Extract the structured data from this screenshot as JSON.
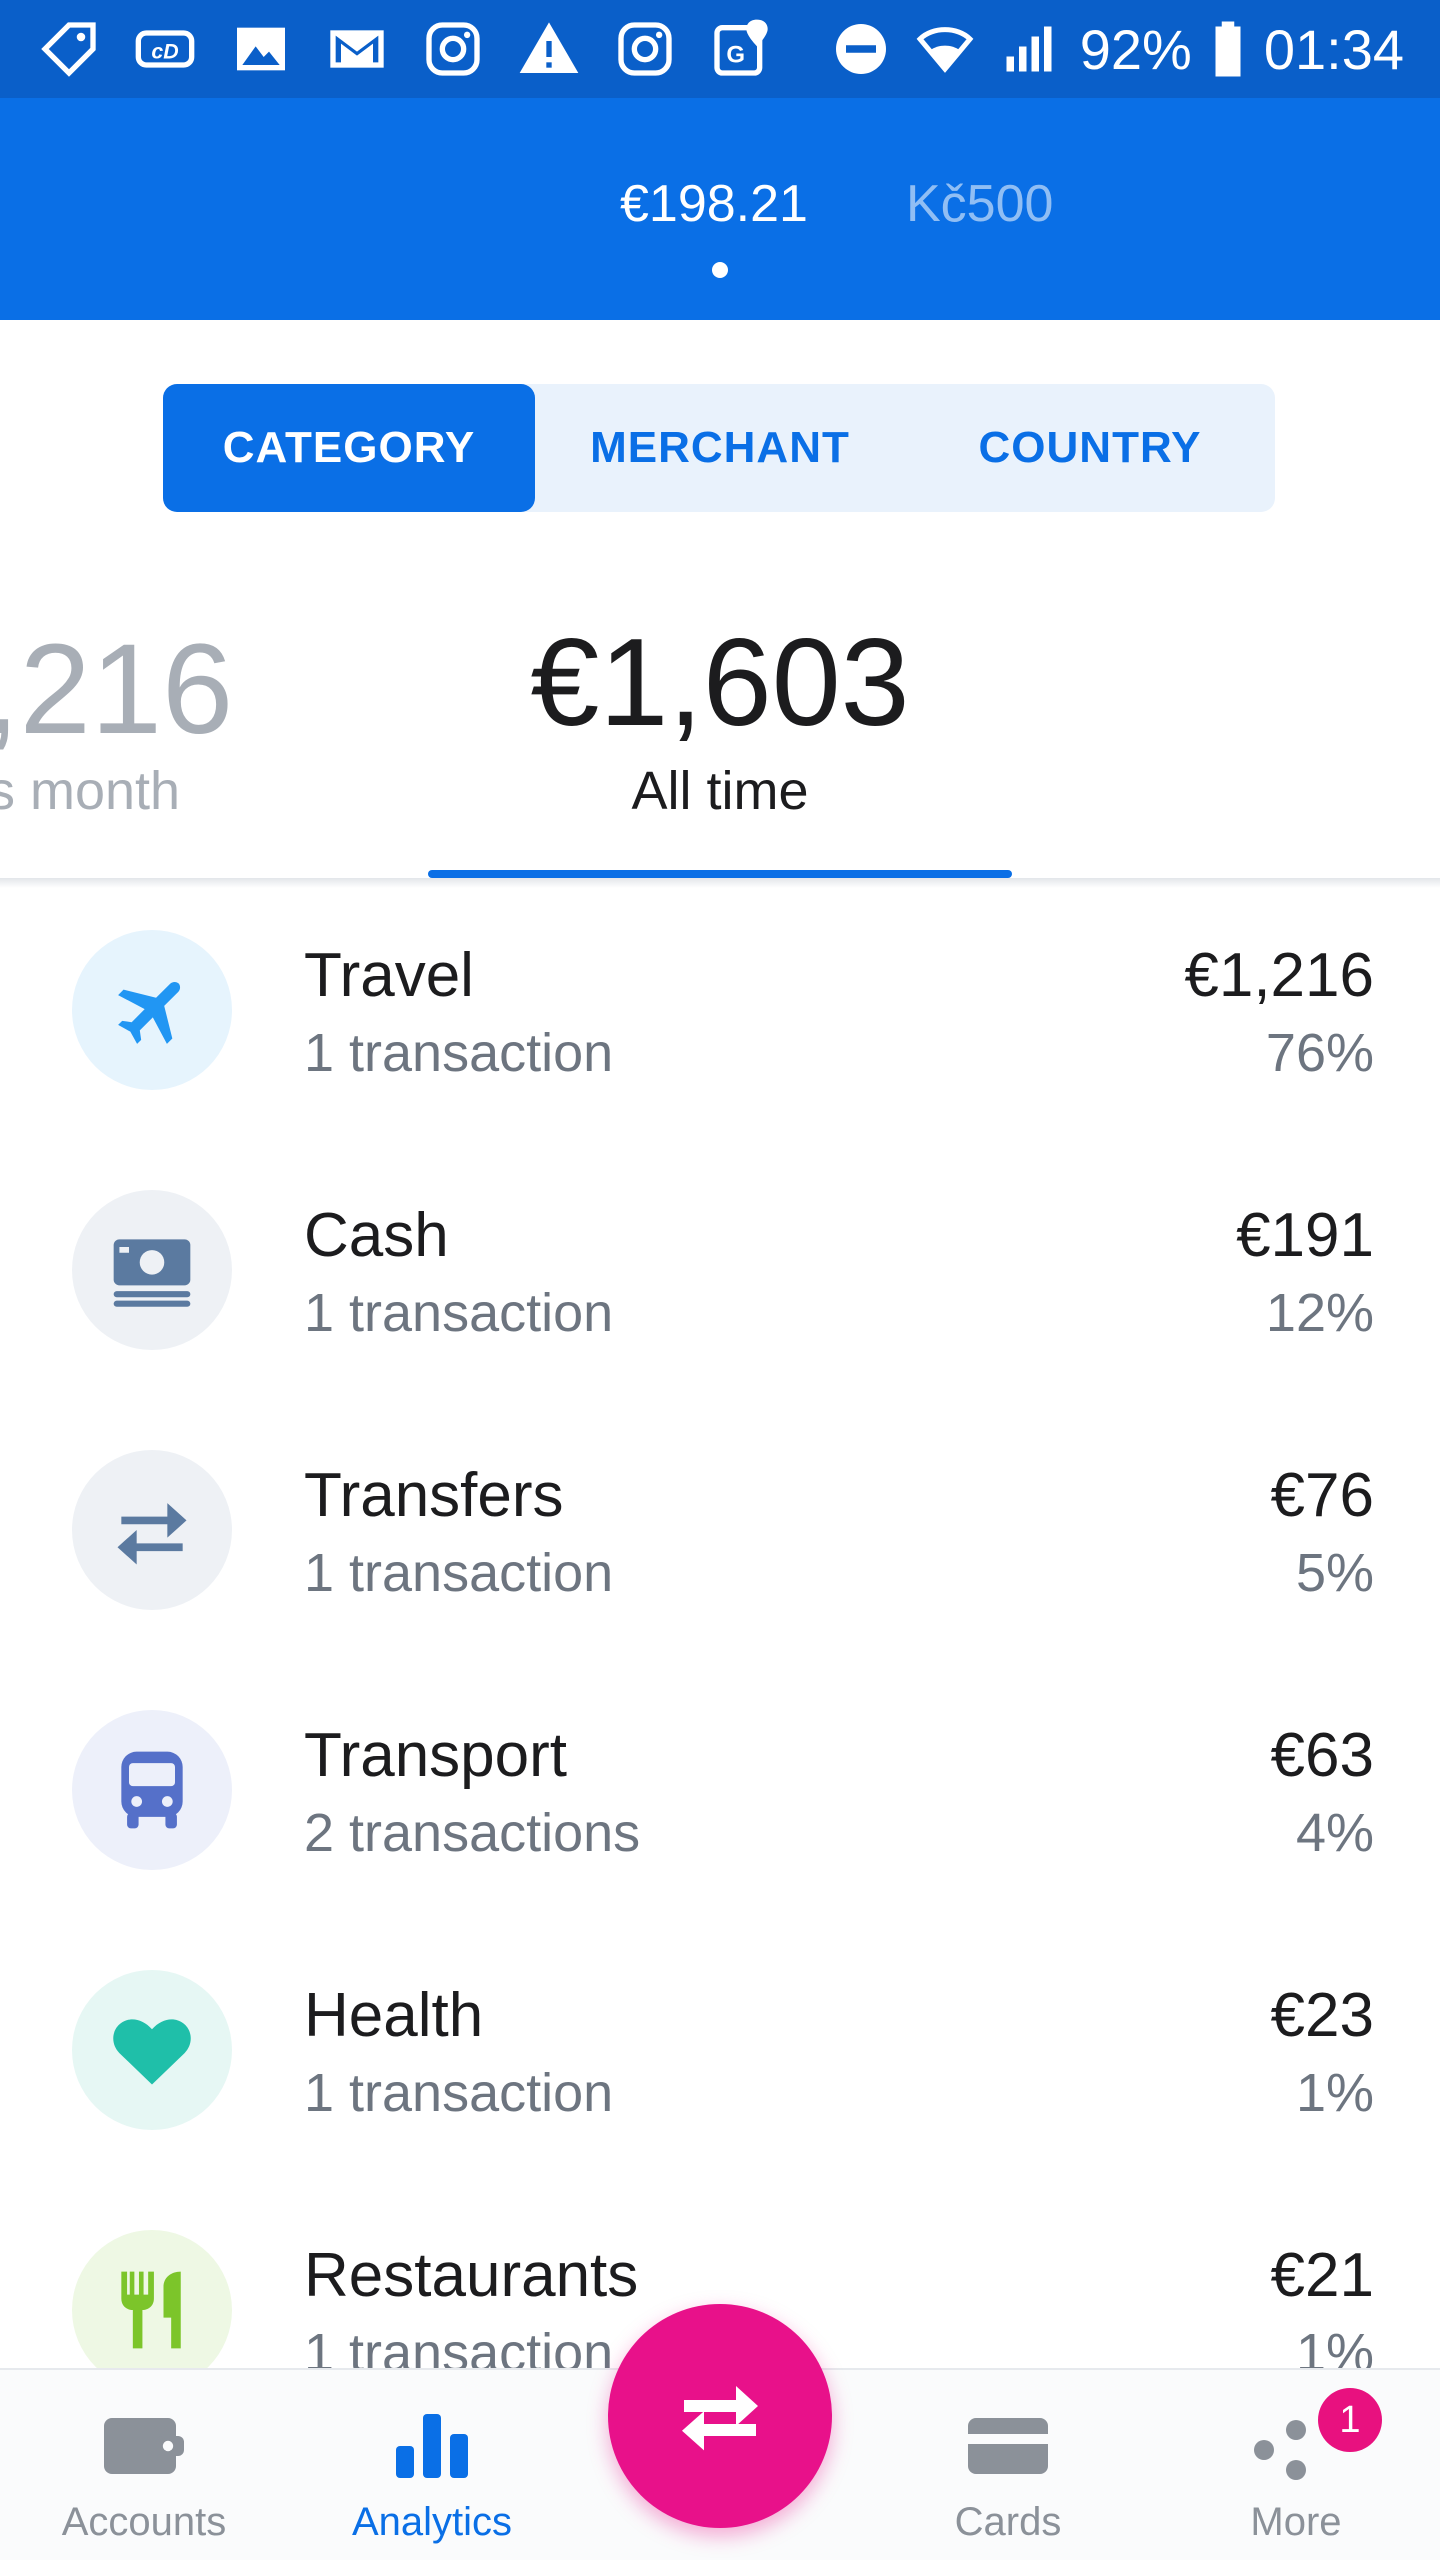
{
  "status_bar": {
    "battery": "92%",
    "time": "01:34"
  },
  "header": {
    "accounts": [
      {
        "label": "€198.21",
        "active": true
      },
      {
        "label": "Kč500",
        "active": false
      }
    ]
  },
  "segment": {
    "tabs": [
      {
        "label": "CATEGORY",
        "active": true
      },
      {
        "label": "MERCHANT",
        "active": false
      },
      {
        "label": "COUNTRY",
        "active": false
      }
    ]
  },
  "totals": {
    "previous": {
      "amount": ",216",
      "label": "s month"
    },
    "current": {
      "amount": "€1,603",
      "label": "All time"
    }
  },
  "categories": [
    {
      "name": "Travel",
      "count": "1 transaction",
      "amount": "€1,216",
      "percent": "76%",
      "icon": "airplane-icon",
      "icon_color": "#2196f3",
      "bg": "#e6f4fd"
    },
    {
      "name": "Cash",
      "count": "1 transaction",
      "amount": "€191",
      "percent": "12%",
      "icon": "cash-icon",
      "icon_color": "#5b7aa0",
      "bg": "#eef1f5"
    },
    {
      "name": "Transfers",
      "count": "1 transaction",
      "amount": "€76",
      "percent": "5%",
      "icon": "transfer-icon",
      "icon_color": "#5b7aa0",
      "bg": "#eef1f5"
    },
    {
      "name": "Transport",
      "count": "2 transactions",
      "amount": "€63",
      "percent": "4%",
      "icon": "bus-icon",
      "icon_color": "#5570c9",
      "bg": "#edf0fa"
    },
    {
      "name": "Health",
      "count": "1 transaction",
      "amount": "€23",
      "percent": "1%",
      "icon": "heart-icon",
      "icon_color": "#1fbfa9",
      "bg": "#e6f7f4"
    },
    {
      "name": "Restaurants",
      "count": "1 transaction",
      "amount": "€21",
      "percent": "1%",
      "icon": "cutlery-icon",
      "icon_color": "#7cc52a",
      "bg": "#eef8e4"
    }
  ],
  "bottom_nav": {
    "items": [
      {
        "label": "Accounts",
        "icon": "wallet-icon",
        "active": false
      },
      {
        "label": "Analytics",
        "icon": "bar-chart-icon",
        "active": true
      },
      {
        "label": "Cards",
        "icon": "card-icon",
        "active": false
      },
      {
        "label": "More",
        "icon": "more-dots-icon",
        "active": false
      }
    ],
    "more_badge": "1",
    "fab_icon": "transfer-arrows-icon"
  },
  "colors": {
    "primary": "#0a6fe6",
    "status_bar": "#0a5fc9",
    "fab": "#e8118a",
    "badge": "#e8117f"
  }
}
